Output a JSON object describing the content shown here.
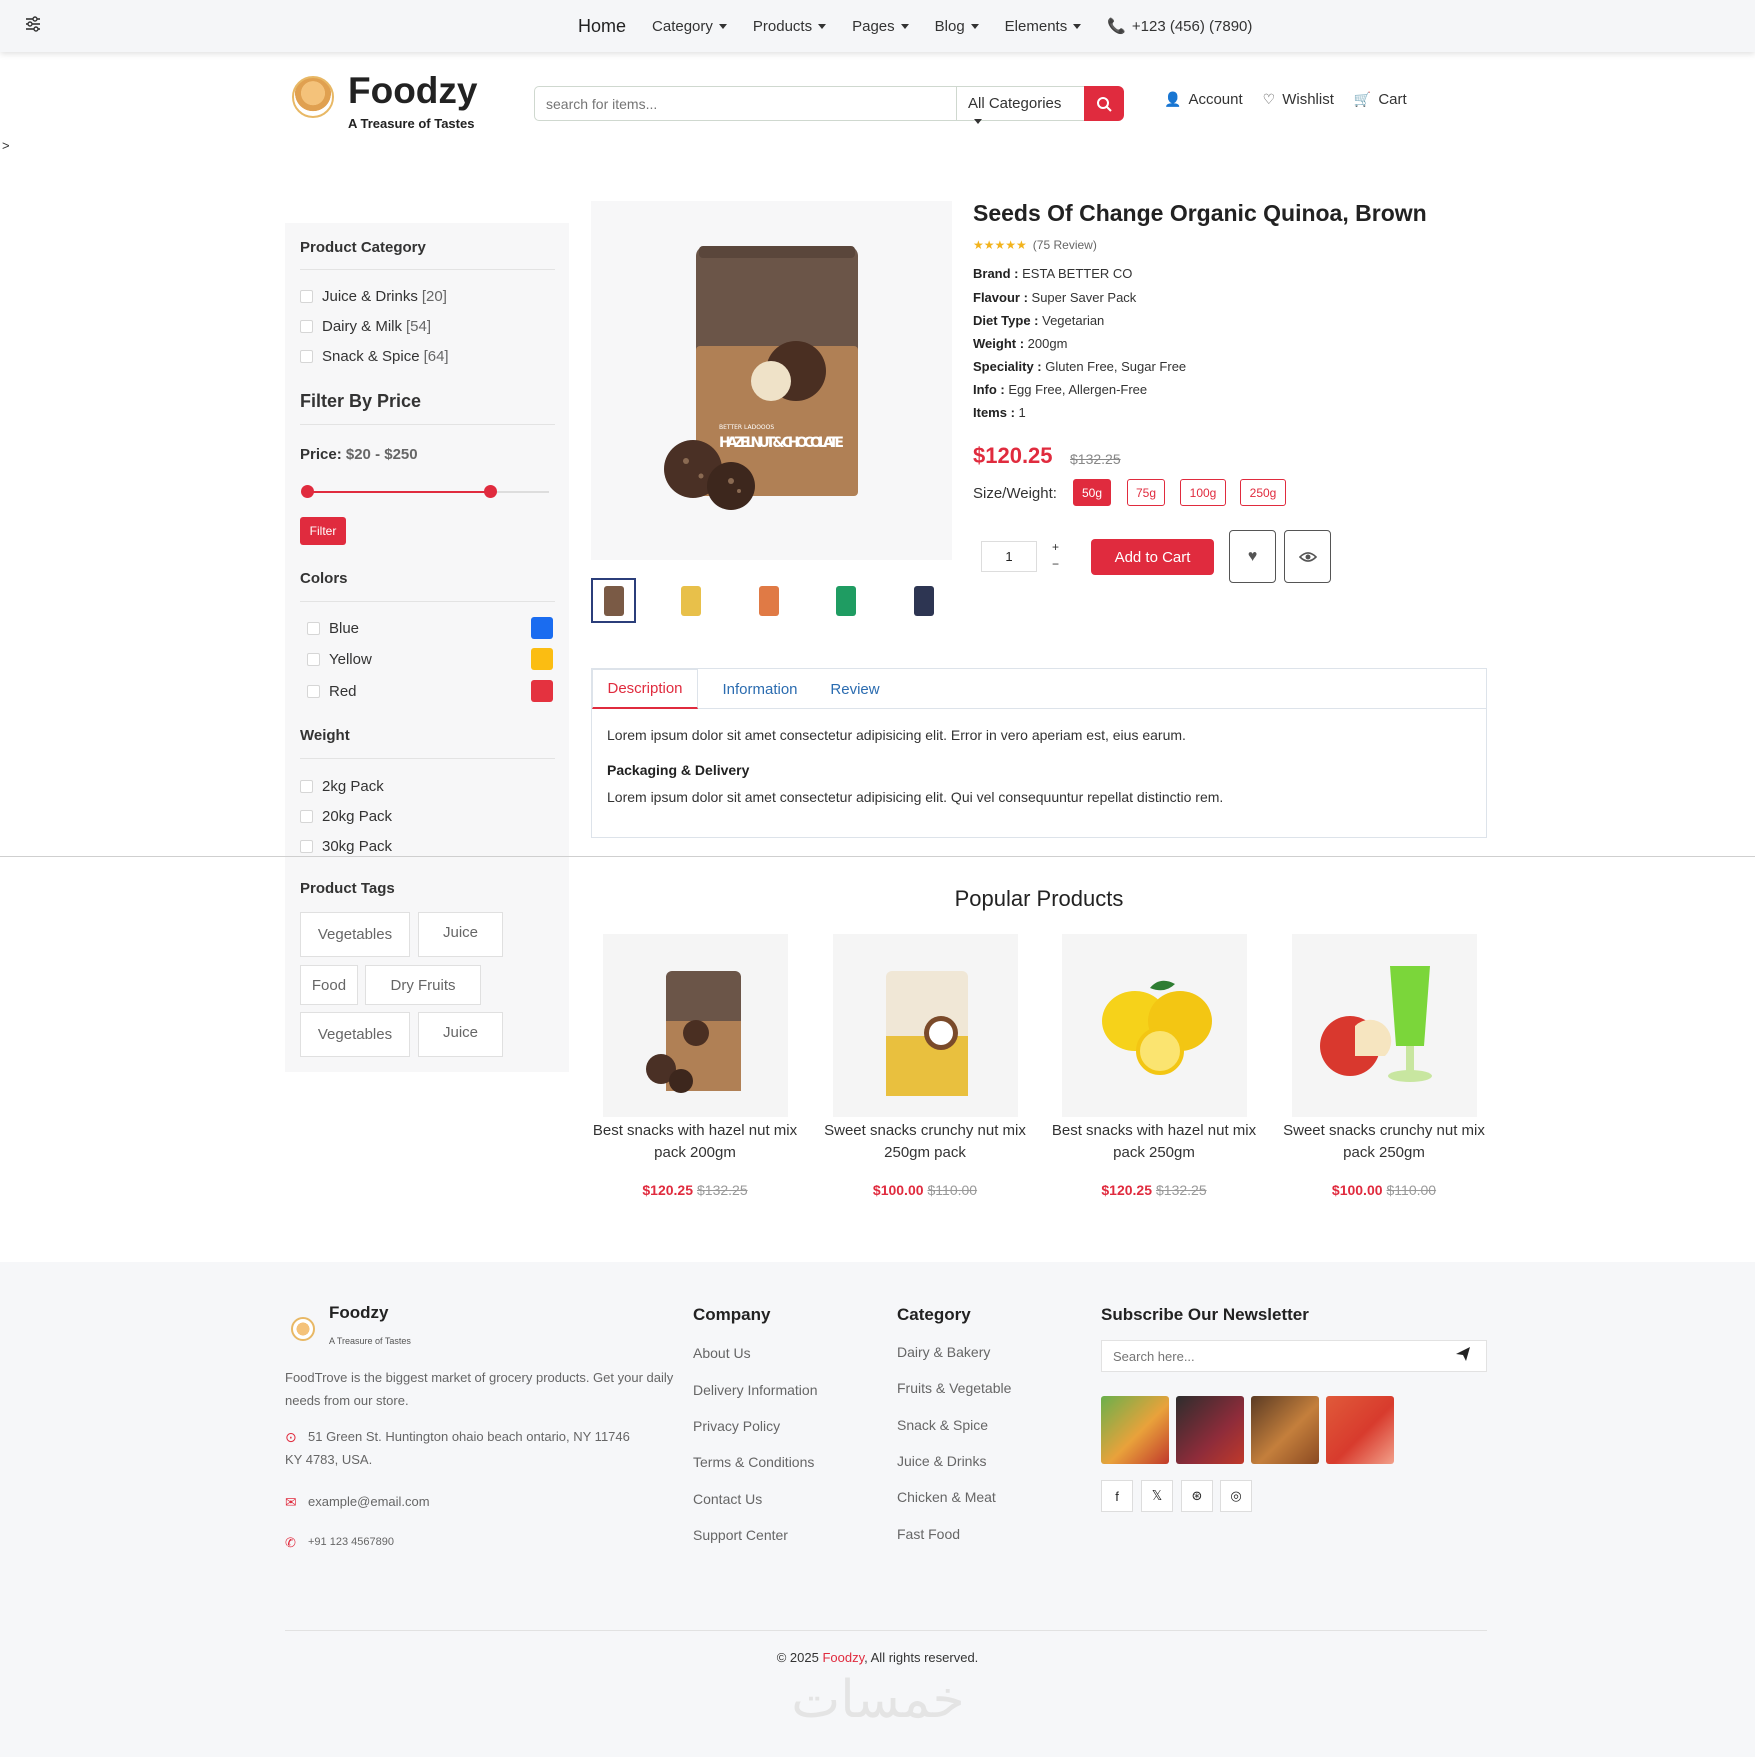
{
  "nav": {
    "home": "Home",
    "items": [
      "Category",
      "Products",
      "Pages",
      "Blog",
      "Elements"
    ],
    "phone": "+123 (456) (7890)"
  },
  "header": {
    "brand": "Foodzy",
    "tagline": "A Treasure of Tastes",
    "search_placeholder": "search for items...",
    "category_select": "All Categories",
    "account": "Account",
    "wishlist": "Wishlist",
    "cart": "Cart",
    "arrow": ">"
  },
  "sidebar": {
    "category_title": "Product Category",
    "categories": [
      {
        "label": "Juice & Drinks",
        "count": "[20]"
      },
      {
        "label": "Dairy & Milk",
        "count": "[54]"
      },
      {
        "label": "Snack & Spice",
        "count": "[64]"
      }
    ],
    "price_title": "Filter By Price",
    "price_label": "Price:",
    "price_range": "$20 - $250",
    "price_slider": {
      "min_fraction": 0.0,
      "max_fraction": 0.76
    },
    "filter_btn": "Filter",
    "colors_title": "Colors",
    "colors": [
      {
        "label": "Blue",
        "hex": "#1a6cf0"
      },
      {
        "label": "Yellow",
        "hex": "#fbbd12"
      },
      {
        "label": "Red",
        "hex": "#e4323f"
      }
    ],
    "weight_title": "Weight",
    "weights": [
      "2kg Pack",
      "20kg Pack",
      "30kg Pack"
    ],
    "tags_title": "Product Tags",
    "tags": [
      "Vegetables",
      "Juice",
      "Food",
      "Dry Fruits",
      "Vegetables",
      "Juice"
    ]
  },
  "product": {
    "title": "Seeds Of Change Organic Quinoa, Brown",
    "stars": "★★★★★",
    "reviews": "(75 Review)",
    "specs": [
      {
        "k": "Brand :",
        "v": "ESTA BETTER CO"
      },
      {
        "k": "Flavour :",
        "v": "Super Saver Pack"
      },
      {
        "k": "Diet Type :",
        "v": "Vegetarian"
      },
      {
        "k": "Weight :",
        "v": "200gm"
      },
      {
        "k": "Speciality :",
        "v": "Gluten Free, Sugar Free"
      },
      {
        "k": "Info :",
        "v": "Egg Free, Allergen-Free"
      },
      {
        "k": "Items :",
        "v": "1"
      }
    ],
    "price": "$120.25",
    "old_price": "$132.25",
    "size_label": "Size/Weight:",
    "sizes": [
      "50g",
      "75g",
      "100g",
      "250g"
    ],
    "qty": "1",
    "plus": "+",
    "minus": "−",
    "add_to_cart": "Add to Cart",
    "pack_text": "HAZELNUT & CHOCOLATE",
    "pack_small": "BETTER LADOOOS"
  },
  "tabs": {
    "items": [
      "Description",
      "Information",
      "Review"
    ],
    "body1": "Lorem ipsum dolor sit amet consectetur adipisicing elit. Error in vero aperiam est, eius earum.",
    "subhead": "Packaging & Delivery",
    "body2": "Lorem ipsum dolor sit amet consectetur adipisicing elit. Qui vel consequuntur repellat distinctio rem."
  },
  "popular": {
    "title": "Popular Products",
    "items": [
      {
        "name": "Best snacks with hazel nut mix pack 200gm",
        "price": "$120.25",
        "old": "$132.25"
      },
      {
        "name": "Sweet snacks crunchy nut mix 250gm pack",
        "price": "$100.00",
        "old": "$110.00"
      },
      {
        "name": "Best snacks with hazel nut mix pack 250gm",
        "price": "$120.25",
        "old": "$132.25"
      },
      {
        "name": "Sweet snacks crunchy nut mix pack 250gm",
        "price": "$100.00",
        "old": "$110.00"
      }
    ]
  },
  "footer": {
    "brand": "Foodzy",
    "tagline": "A Treasure of Tastes",
    "about": "FoodTrove is the biggest market of grocery products. Get your daily needs from our store.",
    "address": "51 Green St. Huntington ohaio beach ontario, NY 11746 KY 4783, USA.",
    "email": "example@email.com",
    "phone": "+91 123 4567890",
    "company_title": "Company",
    "company": [
      "About Us",
      "Delivery Information",
      "Privacy Policy",
      "Terms & Conditions",
      "Contact Us",
      "Support Center"
    ],
    "category_title": "Category",
    "category": [
      "Dairy & Bakery",
      "Fruits & Vegetable",
      "Snack & Spice",
      "Juice & Drinks",
      "Chicken & Meat",
      "Fast Food"
    ],
    "newsletter_title": "Subscribe Our Newsletter",
    "newsletter_placeholder": "Search here...",
    "social": [
      "f",
      "𝕏",
      "⊛",
      "◎"
    ],
    "copyright_pre": "© 2025 ",
    "copyright_brand": "Foodzy",
    "copyright_post": ", All rights reserved.",
    "watermark": "خمسات"
  },
  "colors": {
    "accent": "#e02b3e",
    "link": "#2b6cb0"
  }
}
